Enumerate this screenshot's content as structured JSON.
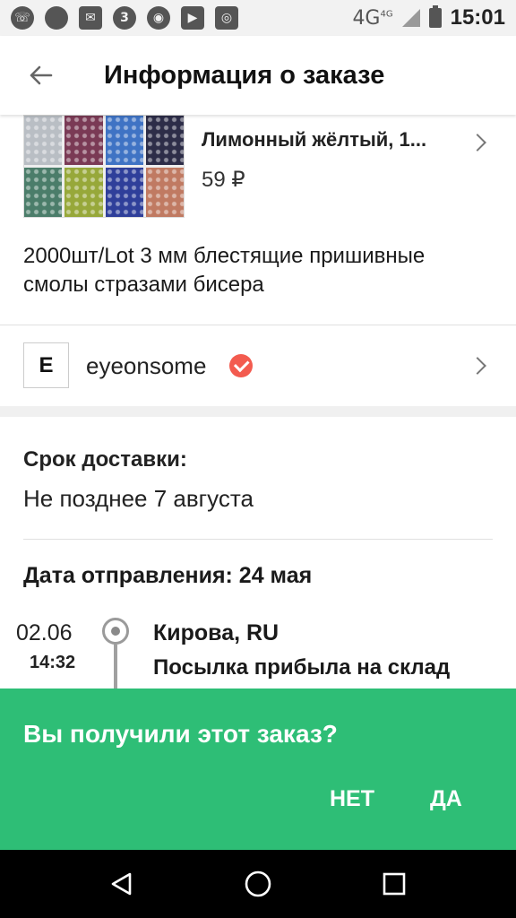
{
  "status_bar": {
    "icons": [
      "whatsapp-icon",
      "circle-app-icon",
      "gmail-icon",
      "number-3-app-icon",
      "chrome-icon",
      "youtube-icon",
      "instagram-icon"
    ],
    "icon_glyph_3": "3",
    "network": "4G",
    "network_sup": "4G",
    "time": "15:01"
  },
  "app_bar": {
    "title": "Информация о заказе"
  },
  "product": {
    "name": "Лимонный жёлтый, 1...",
    "price": "59 ₽",
    "title": "2000шт/Lot 3 мм блестящие пришивные смолы стразами бисера",
    "swatch_colors": [
      "#b9bec4",
      "#7a3a55",
      "#3f73c4",
      "#2d2d48",
      "#4b7d6a",
      "#97a83a",
      "#2f3f9a",
      "#c07a62"
    ]
  },
  "seller": {
    "logo_letter": "E",
    "name": "eyeonsome"
  },
  "delivery": {
    "label": "Срок доставки:",
    "value": "Не позднее 7 августа"
  },
  "shipping": {
    "date_label": "Дата отправления: 24 мая"
  },
  "tracking": {
    "events": [
      {
        "date": "02.06",
        "time": "14:32",
        "location": "Кирова, RU",
        "description": "Посылка прибыла на склад"
      }
    ]
  },
  "confirm": {
    "question": "Вы получили этот заказ?",
    "no_label": "НЕТ",
    "yes_label": "ДА",
    "color": "#2ebe76"
  },
  "nav": {
    "icons": [
      "back-triangle-icon",
      "home-circle-icon",
      "recents-square-icon"
    ]
  }
}
